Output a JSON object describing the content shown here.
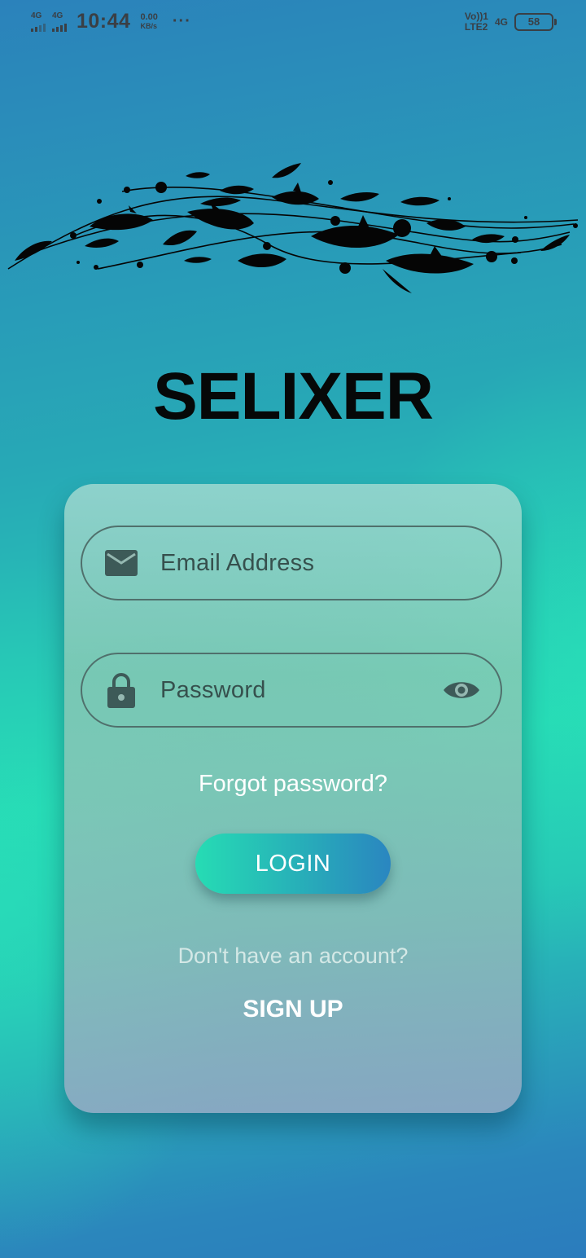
{
  "status_bar": {
    "sim1_network": "4G",
    "sim2_network": "4G",
    "time": "10:44",
    "speed_value": "0.00",
    "speed_unit": "KB/s",
    "more": "···",
    "volte_line1": "Vo))1",
    "volte_line2": "LTE2",
    "right_network": "4G",
    "battery_level": "58"
  },
  "app": {
    "title": "SELIXER"
  },
  "login_form": {
    "email_placeholder": "Email Address",
    "password_placeholder": "Password",
    "forgot_password": "Forgot password?",
    "login_button": "LOGIN",
    "no_account_text": "Don't have an account?",
    "signup_link": "SIGN UP"
  },
  "colors": {
    "title": "#060808",
    "field_border": "#50706c",
    "field_text": "#36504d",
    "button_gradient_start": "#26dcb4",
    "button_gradient_end": "#2a86c0"
  },
  "icons": {
    "email_field": "envelope-icon",
    "password_field": "lock-icon",
    "password_toggle": "eye-icon"
  }
}
